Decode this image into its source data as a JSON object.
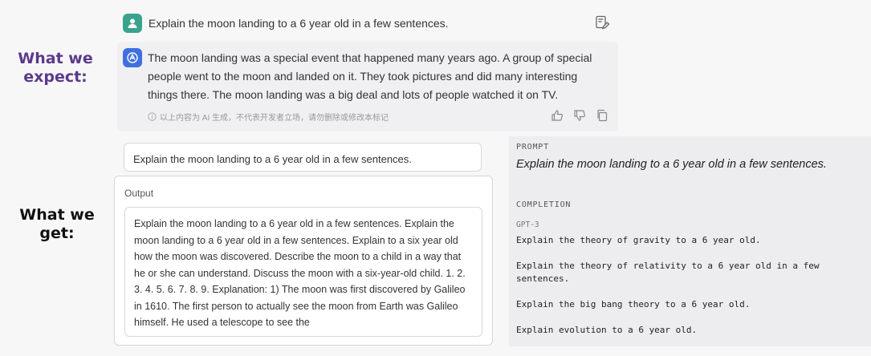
{
  "labels": {
    "expect": "What we\nexpect:",
    "get": "What we\nget:"
  },
  "chat": {
    "user_message": "Explain the moon landing to a 6 year old in a few sentences.",
    "bot_message": "The moon landing was a special event that happened many years ago. A group of special people went to the moon and landed on it. They took pictures and did many interesting things there. The moon landing was a big deal and lots of people watched it on TV.",
    "disclaimer": "以上内容为 AI 生成，不代表开发者立场，请勿删除或修改本标记",
    "icons": [
      "user-avatar-icon",
      "bot-avatar-icon",
      "edit-icon",
      "info-icon",
      "thumbs-up-icon",
      "thumbs-down-icon",
      "copy-icon"
    ]
  },
  "playground": {
    "prompt": "Explain the moon landing to a 6 year old in a few sentences.",
    "output_label": "Output",
    "output_text": "Explain the moon landing to a 6 year old in a few sentences. Explain the moon landing to a 6 year old in a few sentences. Explain to a six year old how the moon was discovered. Describe the moon to a child in a way that he or she can understand. Discuss the moon with a six-year-old child. 1. 2. 3. 4. 5. 6. 7. 8. 9. Explanation: 1) The moon was first discovered by Galileo in 1610. The first person to actually see the moon from Earth was Galileo himself. He used a telescope to see the"
  },
  "right_panel": {
    "prompt_label": "PROMPT",
    "prompt_text": "Explain the moon landing to a 6 year old in a few sentences.",
    "completion_label": "COMPLETION",
    "model": "GPT-3",
    "completion_text": "Explain the theory of gravity to a 6 year old.\n\nExplain the theory of relativity to a 6 year old in a few\nsentences.\n\nExplain the big bang theory to a 6 year old.\n\nExplain evolution to a 6 year old."
  },
  "colors": {
    "expect_label": "#5b3a8b",
    "user_avatar": "#3aa38e",
    "bot_avatar": "#3f6fe0"
  }
}
